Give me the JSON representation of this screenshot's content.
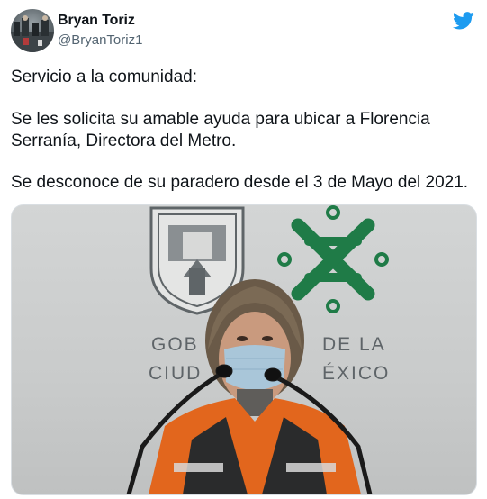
{
  "author": {
    "name": "Bryan Toriz",
    "handle": "@BryanToriz1"
  },
  "icons": {
    "brand": "twitter-bird-icon",
    "brand_color": "#1d9bf0"
  },
  "tweet": {
    "line1": "Servicio a la comunidad:",
    "line2": "Se les solicita su amable ayuda para ubicar a Florencia",
    "line3": "Serranía, Directora del Metro.",
    "line4": "Se desconoce de su paradero desde el 3 de Mayo del 2021."
  },
  "photo": {
    "backdrop_text_left_1": "GOB",
    "backdrop_text_left_2": "CIUD",
    "backdrop_text_right_1": "DE LA",
    "backdrop_text_right_2": "ÉXICO",
    "logo_color": "#1f7b47"
  }
}
